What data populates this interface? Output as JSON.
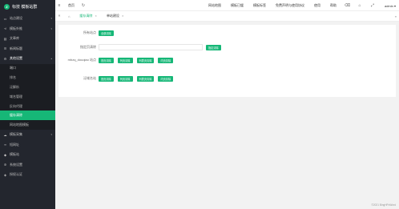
{
  "logo": {
    "mark": "Z",
    "text": "标技 模板站群"
  },
  "sidebar": {
    "items_top": [
      {
        "label": "站点建设",
        "icon": "monitor-icon"
      },
      {
        "label": "模板外推",
        "icon": "share-icon"
      },
      {
        "label": "文章库",
        "icon": "book-icon"
      },
      {
        "label": "新闻标题",
        "icon": "list-icon"
      }
    ],
    "open_group": {
      "label": "其他设置",
      "icon": "settings-icon"
    },
    "sub_items": [
      "端口",
      "排名",
      "泛解析",
      "域名管理",
      "反向代理",
      "缓存清除",
      "网站地图模板"
    ],
    "active_sub": 5,
    "items_bottom": [
      {
        "label": "模板采集",
        "icon": "cloud-icon"
      },
      {
        "label": "短网址",
        "icon": "link-icon"
      },
      {
        "label": "模板站",
        "icon": "bookmark-icon"
      },
      {
        "label": "系统设置",
        "icon": "gear-icon"
      },
      {
        "label": "授权认证",
        "icon": "shield-icon"
      }
    ]
  },
  "topbar": {
    "menu_icon": "≡",
    "home_label": "首页",
    "refresh_icon": "↻",
    "nav": [
      "网站地图",
      "模板已缓",
      "模板标签",
      "免费声明与使用协议",
      "使用",
      "帮助"
    ],
    "user": "admin ▾"
  },
  "tabs": {
    "items": [
      {
        "label": "缓存清除",
        "active": true
      },
      {
        "label": "单站建设",
        "active": false
      }
    ],
    "home_icon": "⌂"
  },
  "form": {
    "rows": [
      {
        "label": "所有站点",
        "buttons": [
          "全部清除"
        ]
      },
      {
        "label": "指定页清除",
        "input": true,
        "buttons": [
          "指定清除"
        ]
      },
      {
        "label": "mbzq_douqiao 站点",
        "buttons": [
          "首页清除",
          "列页清除",
          "列表页清除",
          "内页清除"
        ]
      },
      {
        "label": "泛域名站",
        "buttons": [
          "首页清除",
          "列页清除",
          "列表页清除",
          "内页清除"
        ]
      }
    ]
  },
  "footer": "©2021 BingHPoWord"
}
